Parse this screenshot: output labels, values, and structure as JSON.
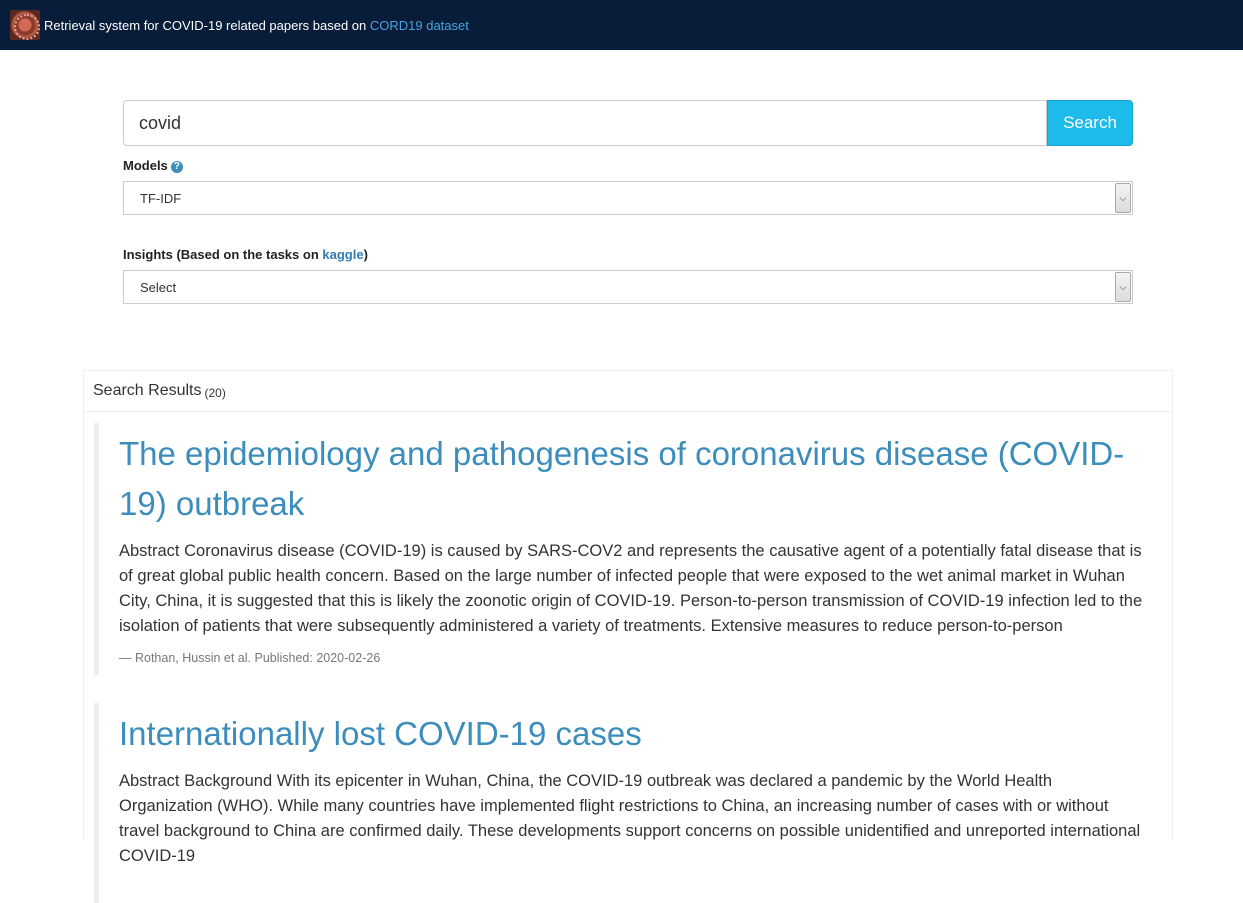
{
  "header": {
    "title_text": "Retrieval system for COVID-19 related papers based on ",
    "dataset_link": "CORD19 dataset",
    "logo_icon": "coronavirus-logo-icon"
  },
  "search": {
    "value": "covid",
    "button_label": "Search"
  },
  "models": {
    "label": "Models",
    "help_icon": "question-circle-icon",
    "selected": "TF-IDF"
  },
  "insights": {
    "label_prefix": "Insights (Based on the tasks on ",
    "link": "kaggle",
    "label_suffix": ")",
    "selected": "Select"
  },
  "results": {
    "header": "Search Results",
    "count": "(20)",
    "items": [
      {
        "title": "The epidemiology and pathogenesis of coronavirus disease (COVID-19) outbreak",
        "abstract": "Abstract Coronavirus disease (COVID-19) is caused by SARS-COV2 and represents the causative agent of a potentially fatal disease that is of great global public health concern. Based on the large number of infected people that were exposed to the wet animal market in Wuhan City, China, it is suggested that this is likely the zoonotic origin of COVID-19. Person-to-person transmission of COVID-19 infection led to the isolation of patients that were subsequently administered a variety of treatments. Extensive measures to reduce person-to-person",
        "meta": "— Rothan, Hussin et al. Published: 2020-02-26"
      },
      {
        "title": "Internationally lost COVID-19 cases",
        "abstract": "Abstract Background With its epicenter in Wuhan, China, the COVID-19 outbreak was declared a pandemic by the World Health Organization (WHO). While many countries have implemented flight restrictions to China, an increasing number of cases with or without travel background to China are confirmed daily. These developments support concerns on possible unidentified and unreported international COVID-19"
      }
    ]
  }
}
